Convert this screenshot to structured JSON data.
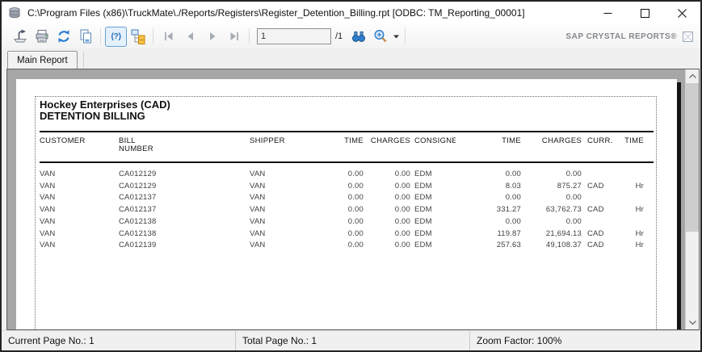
{
  "window": {
    "title": "C:\\Program Files (x86)\\TruckMate\\./Reports/Registers\\Register_Detention_Billing.rpt [ODBC: TM_Reporting_00001]"
  },
  "toolbar": {
    "param_glyph": "(?)",
    "page_number": "1",
    "page_count_suffix": "/1",
    "brand_text": "SAP CRYSTAL REPORTS®",
    "icons": [
      "export-icon",
      "print-icon",
      "refresh-icon",
      "copy-icon",
      "toggle-parameter-panel-icon",
      "toggle-group-tree-icon",
      "first-page-icon",
      "previous-page-icon",
      "next-page-icon",
      "last-page-icon",
      "find-icon",
      "zoom-icon",
      "dropdown-arrow-icon",
      "sap-logo-icon"
    ]
  },
  "tabs": [
    {
      "label": "Main Report"
    }
  ],
  "report": {
    "company": "Hockey Enterprises (CAD)",
    "title": "DETENTION BILLING",
    "columns": [
      "CUSTOMER",
      "BILL\nNUMBER",
      "SHIPPER",
      "TIME",
      "CHARGES",
      "CONSIGNEE",
      "TIME",
      "CHARGES",
      "CURR.",
      "TIME"
    ],
    "rows": [
      [
        "VAN",
        "CA012129",
        "VAN",
        "0.00",
        "0.00",
        "EDM",
        "0.00",
        "0.00",
        "",
        ""
      ],
      [
        "VAN",
        "CA012129",
        "VAN",
        "0.00",
        "0.00",
        "EDM",
        "8.03",
        "875.27",
        "CAD",
        "Hr"
      ],
      [
        "VAN",
        "CA012137",
        "VAN",
        "0.00",
        "0.00",
        "EDM",
        "0.00",
        "0.00",
        "",
        ""
      ],
      [
        "VAN",
        "CA012137",
        "VAN",
        "0.00",
        "0.00",
        "EDM",
        "331.27",
        "63,762.73",
        "CAD",
        "Hr"
      ],
      [
        "VAN",
        "CA012138",
        "VAN",
        "0.00",
        "0.00",
        "EDM",
        "0.00",
        "0.00",
        "",
        ""
      ],
      [
        "VAN",
        "CA012138",
        "VAN",
        "0.00",
        "0.00",
        "EDM",
        "119.87",
        "21,694.13",
        "CAD",
        "Hr"
      ],
      [
        "VAN",
        "CA012139",
        "VAN",
        "0.00",
        "0.00",
        "EDM",
        "257.63",
        "49,108.37",
        "CAD",
        "Hr"
      ]
    ]
  },
  "statusbar": {
    "current_page_label": "Current Page No.: 1",
    "total_page_label": "Total Page No.: 1",
    "zoom_label": "Zoom Factor: 100%"
  },
  "colors": {
    "accent_blue": "#2f7fd0",
    "tree_orange": "#f6c44a",
    "viewer_background": "#a6a6a6",
    "page_shadow": "#141414",
    "titlebar_background": "#ffffff"
  }
}
